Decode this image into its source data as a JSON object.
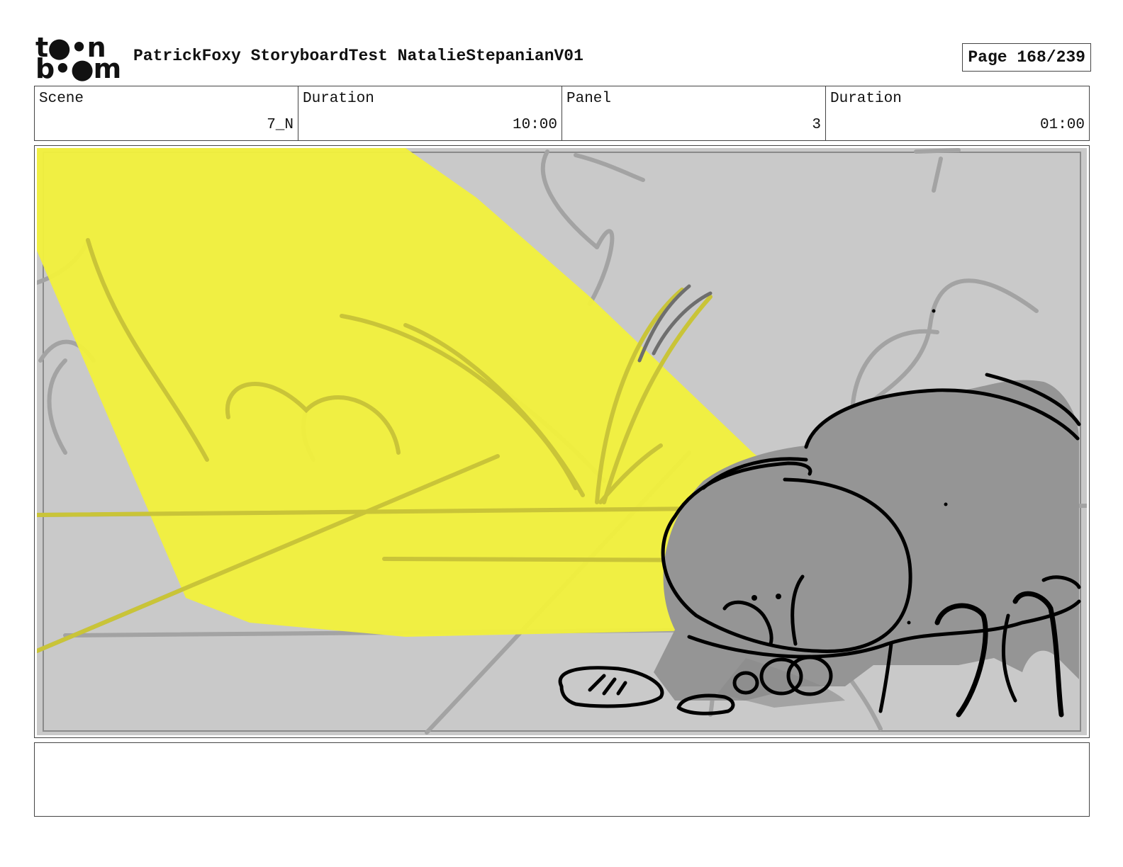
{
  "header": {
    "logo_top": "t●•n",
    "logo_bottom": "b•●m",
    "title": "PatrickFoxy StoryboardTest NatalieStepanianV01",
    "page": "Page 168/239"
  },
  "info": [
    {
      "label": "Scene",
      "value": "7_N"
    },
    {
      "label": "Duration",
      "value": "10:00"
    },
    {
      "label": "Panel",
      "value": "3"
    },
    {
      "label": "Duration",
      "value": "01:00"
    }
  ],
  "panel": {
    "colors": {
      "background": "#c9c9c9",
      "spotlight": "#f1ef3e",
      "character": "#959595",
      "sketch": "#9e9e9e",
      "ink": "#000000"
    }
  },
  "notes": {
    "text": ""
  }
}
